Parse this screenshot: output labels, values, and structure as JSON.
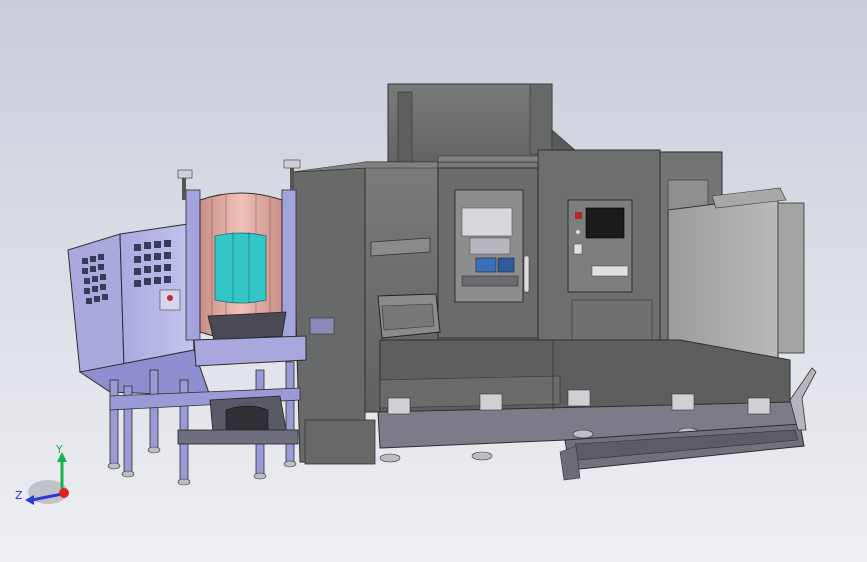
{
  "viewport": {
    "background_top": "#c9ccd9",
    "background_bottom": "#eeeff3"
  },
  "model": {
    "machine_body_color": "#6e6f6f",
    "machine_dark_color": "#555656",
    "loader_cabinet_color": "#b9b9e8",
    "loader_frame_color": "#8f8fd0",
    "drum_color": "#e8b4ac",
    "drum_glass_color": "#33c6c6",
    "control_screen_color": "#1b1b1b"
  },
  "triad": {
    "y_label": "Y",
    "z_label": "Z",
    "y_color": "#19b34a",
    "z_color": "#2a39d8",
    "x_color": "#e12020"
  }
}
